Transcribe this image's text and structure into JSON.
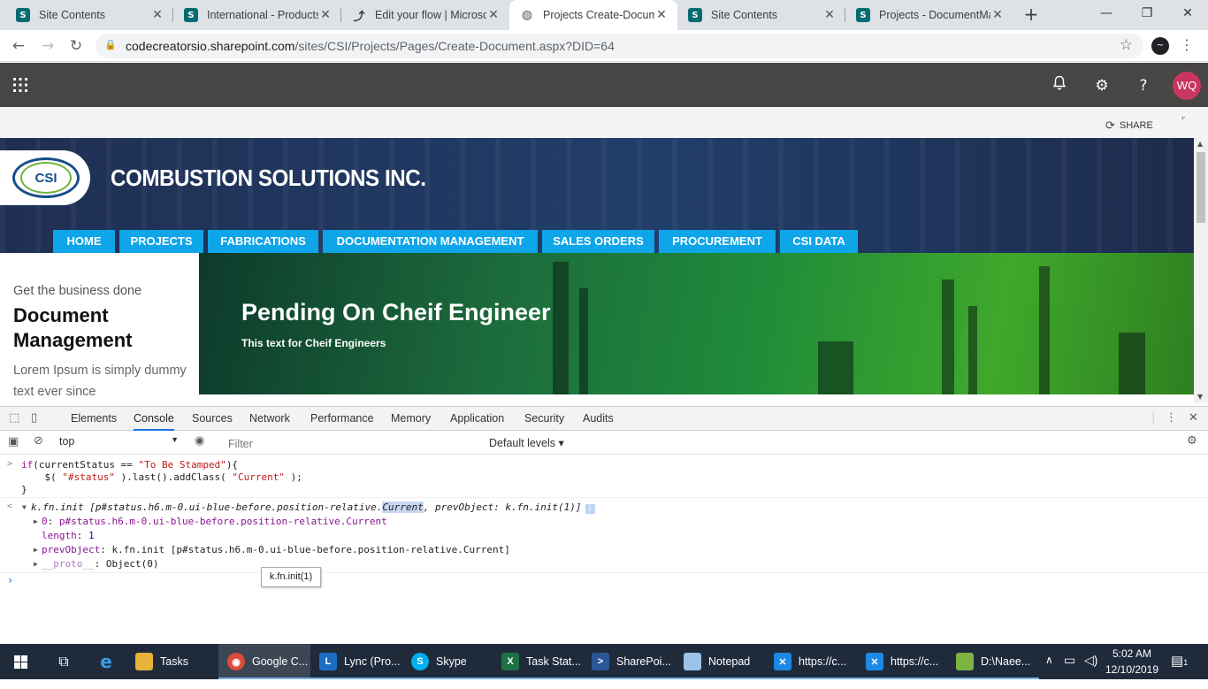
{
  "browser": {
    "tabs": [
      {
        "title": "Site Contents",
        "icon": "sharepoint-icon"
      },
      {
        "title": "International - Products",
        "icon": "sharepoint-icon"
      },
      {
        "title": "Edit your flow | Microsoft",
        "icon": "flow-icon"
      },
      {
        "title": "Projects Create-Document",
        "icon": "globe-icon",
        "active": true
      },
      {
        "title": "Site Contents",
        "icon": "sharepoint-icon"
      },
      {
        "title": "Projects - DocumentMa",
        "icon": "sharepoint-icon"
      }
    ],
    "url_host": "codecreatorsio.sharepoint.com",
    "url_path": "/sites/CSI/Projects/Pages/Create-Document.aspx?DID=64"
  },
  "suitebar": {
    "avatar_initials": "WQ"
  },
  "page": {
    "share_label": "SHARE",
    "company_name": "COMBUSTION SOLUTIONS INC.",
    "logo_text": "CSI",
    "nav": [
      "HOME",
      "PROJECTS",
      "FABRICATIONS",
      "DOCUMENTATION MANAGEMENT",
      "SALES ORDERS",
      "PROCUREMENT",
      "CSI DATA"
    ],
    "left_panel": {
      "subtitle": "Get the business done",
      "title": "Document Management",
      "body": "Lorem Ipsum is simply dummy text ever since"
    },
    "hero": {
      "title": "Pending On Cheif Engineer",
      "subtitle": "This text for Cheif Engineers"
    }
  },
  "devtools": {
    "tabs": [
      "Elements",
      "Console",
      "Sources",
      "Network",
      "Performance",
      "Memory",
      "Application",
      "Security",
      "Audits"
    ],
    "active_tab": "Console",
    "context": "top",
    "filter_placeholder": "Filter",
    "levels": "Default levels",
    "console": {
      "input_line1_a": "if",
      "input_line1_b": "(currentStatus == ",
      "input_line1_str": "\"To Be Stamped\"",
      "input_line1_c": "){",
      "input_line2_a": "    $( ",
      "input_line2_str1": "\"#status\"",
      "input_line2_b": " ).last().addClass( ",
      "input_line2_str2": "\"Current\"",
      "input_line2_c": " );",
      "input_line3": "}",
      "result_a": "k.fn.init [p#status.h6.m-0.ui-blue-before.position-relative.",
      "result_hl": "Current",
      "result_b": ", prevObject: k.fn.init(1)]",
      "row0_key": "0",
      "row0_val": "p#status.h6.m-0.ui-blue-before.position-relative.Current",
      "row1_key": "length",
      "row1_val": "1",
      "row2_key": "prevObject",
      "row2_val": "k.fn.init [p#status.h6.m-0.ui-blue-before.position-relative.Current]",
      "row3_key": "__proto__",
      "row3_val": "Object(0)"
    },
    "tooltip": "k.fn.init(1)"
  },
  "taskbar": {
    "items": [
      {
        "label": "Tasks",
        "icon": "folder-icon"
      },
      {
        "label": "Google C...",
        "icon": "chrome-icon",
        "active": true
      },
      {
        "label": "Lync (Pro...",
        "icon": "lync-icon"
      },
      {
        "label": "Skype",
        "icon": "skype-icon"
      },
      {
        "label": "Task Stat...",
        "icon": "excel-icon"
      },
      {
        "label": "SharePoi...",
        "icon": "powershell-icon"
      },
      {
        "label": "Notepad",
        "icon": "notepad-icon"
      },
      {
        "label": "https://c...",
        "icon": "tool-icon"
      },
      {
        "label": "https://c...",
        "icon": "tool-icon"
      },
      {
        "label": "D:\\Naee...",
        "icon": "notepadpp-icon"
      }
    ],
    "time": "5:02 AM",
    "date": "12/10/2019",
    "notification_count": "1"
  },
  "colors": {
    "nav_blue": "#0ea5e9",
    "suitebar": "#484644",
    "avatar": "#c8355f",
    "taskbar": "#1f2b3b"
  }
}
